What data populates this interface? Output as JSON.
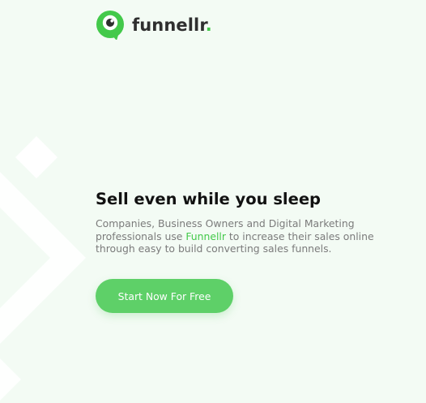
{
  "brand": {
    "name": "funnellr",
    "dot": ".",
    "primary_color": "#43c94a",
    "icon": "chat-bubble-logo-icon"
  },
  "hero": {
    "headline": "Sell even while you sleep",
    "desc_part1": "Companies, Business Owners and Digital Marketing professionals use ",
    "desc_brand": "Funnellr",
    "desc_part2": " to increase their sales online through easy to build  converting sales funnels.",
    "cta_label": "Start Now For Free"
  },
  "colors": {
    "background": "#f3fbf4",
    "button": "#5ed068",
    "heading": "#111111",
    "body_text": "#7b7b7b"
  }
}
